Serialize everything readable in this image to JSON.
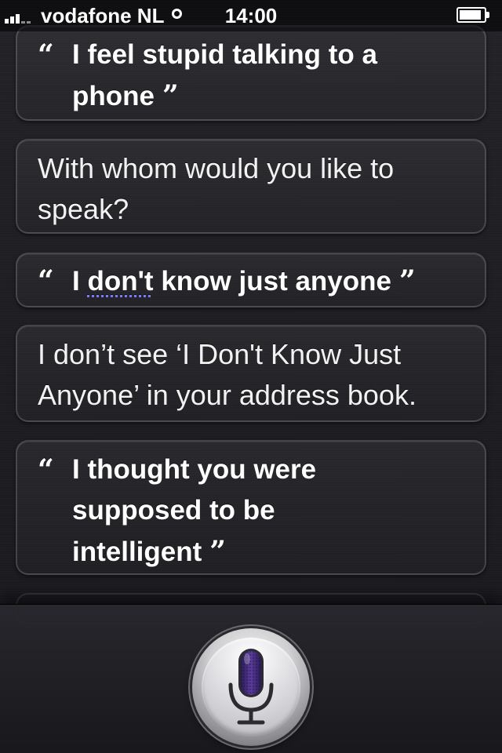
{
  "status_bar": {
    "carrier": "vodafone NL",
    "time": "14:00",
    "battery_level": 0.9
  },
  "conversation": [
    {
      "speaker": "user",
      "line1": "I feel stupid talking to a",
      "line2": "phone"
    },
    {
      "speaker": "siri",
      "line1": "With whom would you like to",
      "line2": "speak?"
    },
    {
      "speaker": "user",
      "line1_underlined": "don't",
      "line1_before": "I",
      "line1_after": "know just anyone"
    },
    {
      "speaker": "siri",
      "line1": "I don’t see ‘I Don't Know Just",
      "line2": "Anyone’ in your address book."
    },
    {
      "speaker": "user",
      "line1": "I thought you were",
      "line2": "supposed to be",
      "line3": "intelligent"
    }
  ],
  "quote_open": "“",
  "quote_close": "”",
  "icons": {
    "signal": "signal-bars-icon",
    "activity": "network-activity-icon",
    "battery": "battery-icon",
    "mic": "microphone-icon"
  },
  "colors": {
    "background": "#1c1c20",
    "mic_accent": "#4b2f82",
    "underline": "#7b7bff"
  }
}
